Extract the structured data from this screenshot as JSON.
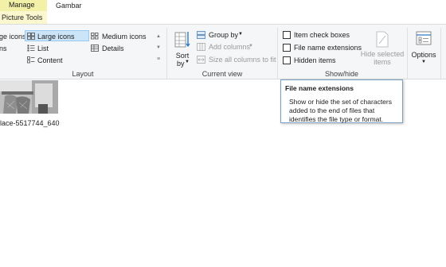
{
  "tabs": {
    "manage": "Manage",
    "gambar": "Gambar",
    "picture_tools": "Picture Tools"
  },
  "colors": {
    "context_tab": "#f3f1a7",
    "context_band": "#fbf8cf",
    "selected_item_bg": "#cce4f7",
    "ribbon_bg": "#f5f6f7"
  },
  "layout": {
    "items": [
      {
        "label": "ge icons",
        "icon": "large-icons-icon"
      },
      {
        "label": "Large icons",
        "icon": "large-icons-icon",
        "selected": true
      },
      {
        "label": "Medium icons",
        "icon": "medium-icons-icon"
      },
      {
        "label": "ns",
        "icon": "list-icon"
      },
      {
        "label": "List",
        "icon": "list-icon"
      },
      {
        "label": "Details",
        "icon": "details-icon"
      },
      {
        "label": "Content",
        "icon": "content-icon"
      }
    ],
    "group_label": "Layout"
  },
  "current_view": {
    "sort_by": {
      "line1": "Sort",
      "line2": "by"
    },
    "group_by": "Group by",
    "add_columns": "Add columns",
    "size_columns": "Size all columns to fit",
    "group_label": "Current view"
  },
  "show_hide": {
    "item_check_boxes": "Item check boxes",
    "file_name_extensions": "File name extensions",
    "hidden_items": "Hidden items",
    "hide_selected": {
      "line1": "Hide selected",
      "line2": "items"
    },
    "group_label": "Show/hide"
  },
  "options": {
    "label": "Options"
  },
  "file": {
    "name": "lace-5517744_640"
  },
  "tooltip": {
    "title": "File name extensions",
    "body": "Show or hide the set of characters added to the end of files that identifies the file type or format."
  }
}
